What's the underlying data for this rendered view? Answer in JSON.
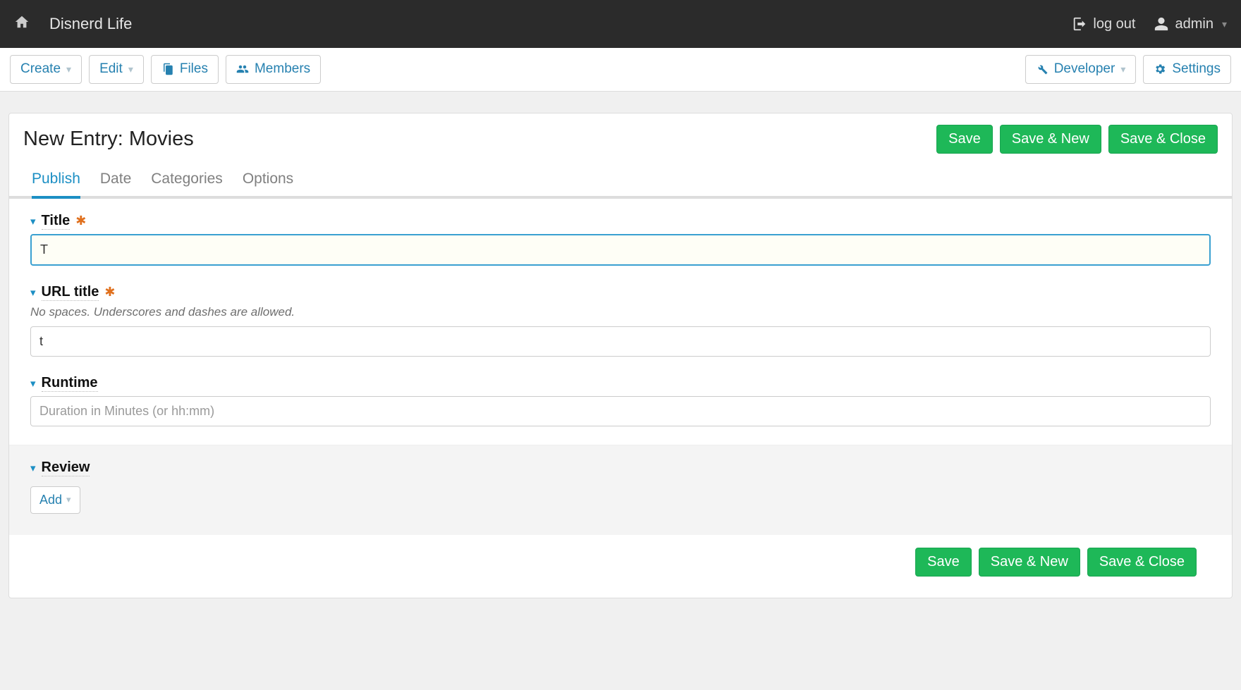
{
  "topbar": {
    "site_name": "Disnerd Life",
    "logout": "log out",
    "user": "admin"
  },
  "toolbar": {
    "create": "Create",
    "edit": "Edit",
    "files": "Files",
    "members": "Members",
    "developer": "Developer",
    "settings": "Settings"
  },
  "panel": {
    "title": "New Entry: Movies",
    "save": "Save",
    "save_new": "Save & New",
    "save_close": "Save & Close"
  },
  "tabs": {
    "publish": "Publish",
    "date": "Date",
    "categories": "Categories",
    "options": "Options"
  },
  "fields": {
    "title": {
      "label": "Title",
      "value": "T"
    },
    "url_title": {
      "label": "URL title",
      "helper": "No spaces. Underscores and dashes are allowed.",
      "value": "t"
    },
    "runtime": {
      "label": "Runtime",
      "placeholder": "Duration in Minutes (or hh:mm)",
      "value": ""
    },
    "review": {
      "label": "Review",
      "add": "Add"
    }
  }
}
